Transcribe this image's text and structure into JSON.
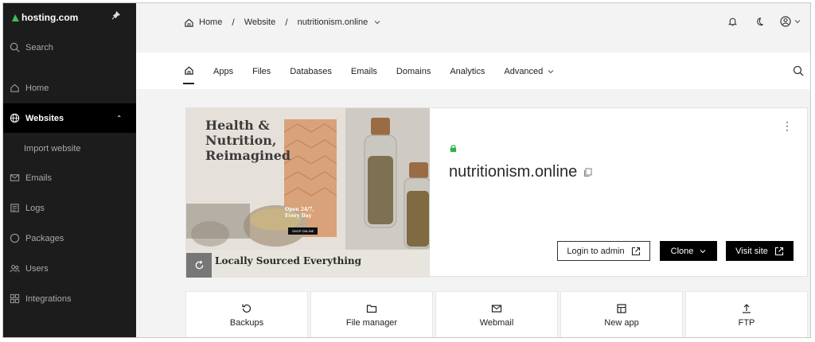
{
  "sidebar": {
    "brand": "hosting.com",
    "search_label": "Search",
    "items": [
      {
        "label": "Home",
        "icon": "home-icon"
      },
      {
        "label": "Websites",
        "icon": "globe-icon",
        "active": true
      },
      {
        "label": "Import website",
        "icon": ""
      },
      {
        "label": "Emails",
        "icon": "mail-icon"
      },
      {
        "label": "Logs",
        "icon": "logs-icon"
      },
      {
        "label": "Packages",
        "icon": "package-icon"
      },
      {
        "label": "Users",
        "icon": "users-icon"
      },
      {
        "label": "Integrations",
        "icon": "integrations-icon"
      }
    ]
  },
  "breadcrumb": {
    "home": "Home",
    "website": "Website",
    "site": "nutritionism.online"
  },
  "tabs": [
    "Apps",
    "Files",
    "Databases",
    "Emails",
    "Domains",
    "Analytics",
    "Advanced"
  ],
  "site": {
    "domain": "nutritionism.online",
    "login_button": "Login to admin",
    "clone_button": "Clone",
    "visit_button": "Visit site",
    "preview": {
      "headline": "Health & Nutrition, Reimagined",
      "footer": "Locally Sourced Everything",
      "badge": "Open 24/7, Every Day",
      "cta": "SHOP ONLINE"
    }
  },
  "tiles": [
    {
      "label": "Backups",
      "icon": "backup-icon"
    },
    {
      "label": "File manager",
      "icon": "folder-icon"
    },
    {
      "label": "Webmail",
      "icon": "mail-icon"
    },
    {
      "label": "New app",
      "icon": "app-icon"
    },
    {
      "label": "FTP",
      "icon": "upload-icon"
    }
  ],
  "colors": {
    "sidebar_bg": "#1c1c1c",
    "active_bg": "#000000",
    "brand_green": "#3cbf5a",
    "lock_green": "#2bb24c"
  }
}
